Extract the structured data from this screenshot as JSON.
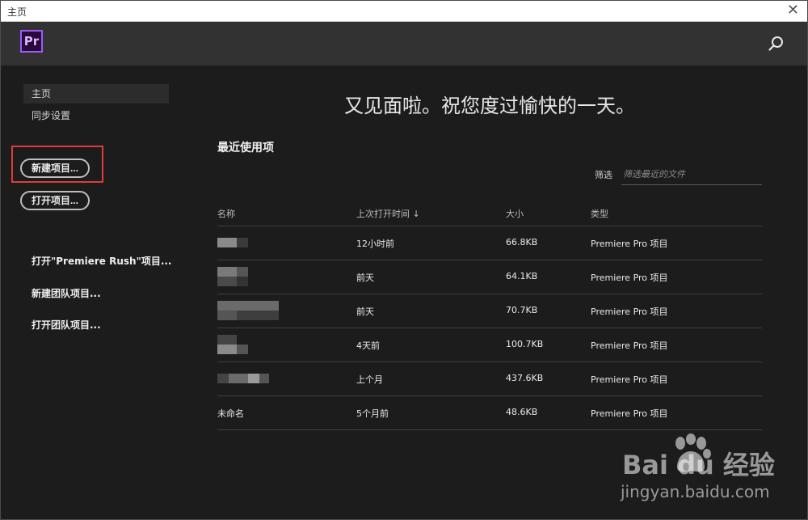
{
  "window": {
    "title": "主页",
    "close_glyph": "✕"
  },
  "header": {
    "logo_text": "Pr"
  },
  "sidebar": {
    "items": [
      {
        "label": "主页"
      },
      {
        "label": "同步设置"
      }
    ],
    "new_project_button": "新建项目...",
    "open_project_button": "打开项目...",
    "open_rush_link": "打开\"Premiere Rush\"项目...",
    "new_team_link": "新建团队项目...",
    "open_team_link": "打开团队项目..."
  },
  "main": {
    "greeting": "又见面啦。祝您度过愉快的一天。",
    "recent_title": "最近使用项",
    "filter_label": "筛选",
    "filter_placeholder": "筛选最近的文件",
    "columns": [
      "名称",
      "上次打开时间 ↓",
      "大小",
      "类型"
    ],
    "rows": [
      {
        "name": "",
        "time": "12小时前",
        "size": "66.8KB",
        "type": "Premiere Pro 项目"
      },
      {
        "name": "",
        "time": "前天",
        "size": "64.1KB",
        "type": "Premiere Pro 项目"
      },
      {
        "name": "",
        "time": "前天",
        "size": "70.7KB",
        "type": "Premiere Pro 项目"
      },
      {
        "name": "",
        "time": "4天前",
        "size": "100.7KB",
        "type": "Premiere Pro 项目"
      },
      {
        "name": "",
        "time": "上个月",
        "size": "437.6KB",
        "type": "Premiere Pro 项目"
      },
      {
        "name": "未命名",
        "time": "5个月前",
        "size": "48.6KB",
        "type": "Premiere Pro 项目"
      }
    ]
  },
  "watermark": {
    "brand": "Bai du 经验",
    "url": "jingyan.baidu.com"
  },
  "colors": {
    "accent_purple": "#9a5cff",
    "highlight_red": "#e03b3b",
    "background": "#1c1c1c",
    "header": "#323232"
  }
}
